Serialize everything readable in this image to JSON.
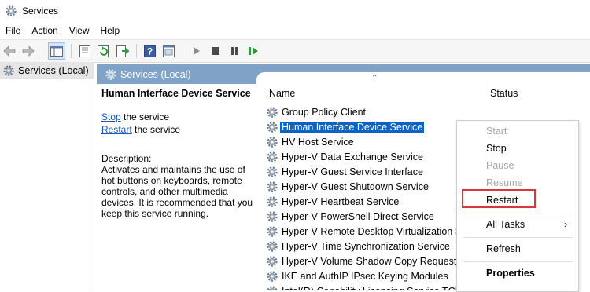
{
  "window": {
    "title": "Services",
    "icon": "gear-icon"
  },
  "menu": [
    "File",
    "Action",
    "View",
    "Help"
  ],
  "toolbar": {
    "icons": [
      "back-arrow-icon",
      "forward-arrow-icon",
      "show-tree-icon",
      "properties-icon",
      "refresh-icon",
      "export-icon",
      "help-icon",
      "console-icon",
      "start-icon",
      "stop-icon",
      "pause-icon",
      "resume-icon"
    ]
  },
  "tree": {
    "root_label": "Services (Local)"
  },
  "main": {
    "header_label": "Services (Local)",
    "selected_title": "Human Interface Device Service",
    "stop_link": "Stop",
    "stop_rest": " the service",
    "restart_link": "Restart",
    "restart_rest": " the service",
    "description_label": "Description:",
    "description_lines": [
      "Activates and maintains the use of",
      "hot buttons on keyboards, remote",
      "controls, and other multimedia",
      "devices. It is recommended that you",
      "keep this service running."
    ]
  },
  "list": {
    "col_name": "Name",
    "col_status": "Status",
    "rows": [
      "Group Policy Client",
      "Human Interface Device Service",
      "HV Host Service",
      "Hyper-V Data Exchange Service",
      "Hyper-V Guest Service Interface",
      "Hyper-V Guest Shutdown Service",
      "Hyper-V Heartbeat Service",
      "Hyper-V PowerShell Direct Service",
      "Hyper-V Remote Desktop Virtualization Se",
      "Hyper-V Time Synchronization Service",
      "Hyper-V Volume Shadow Copy Requestor",
      "IKE and AuthIP IPsec Keying Modules",
      "Intel(R) Capability Licensing Service TCP IP"
    ],
    "selected_index": 1
  },
  "context_menu": {
    "start": "Start",
    "stop": "Stop",
    "pause": "Pause",
    "resume": "Resume",
    "restart": "Restart",
    "all_tasks": "All Tasks",
    "all_tasks_arrow": "›",
    "refresh": "Refresh",
    "properties": "Properties"
  },
  "colors": {
    "header_bg": "#7fa2c6",
    "selection": "#0b63c7",
    "highlight_box": "#d7363b",
    "link": "#1a57c4"
  }
}
